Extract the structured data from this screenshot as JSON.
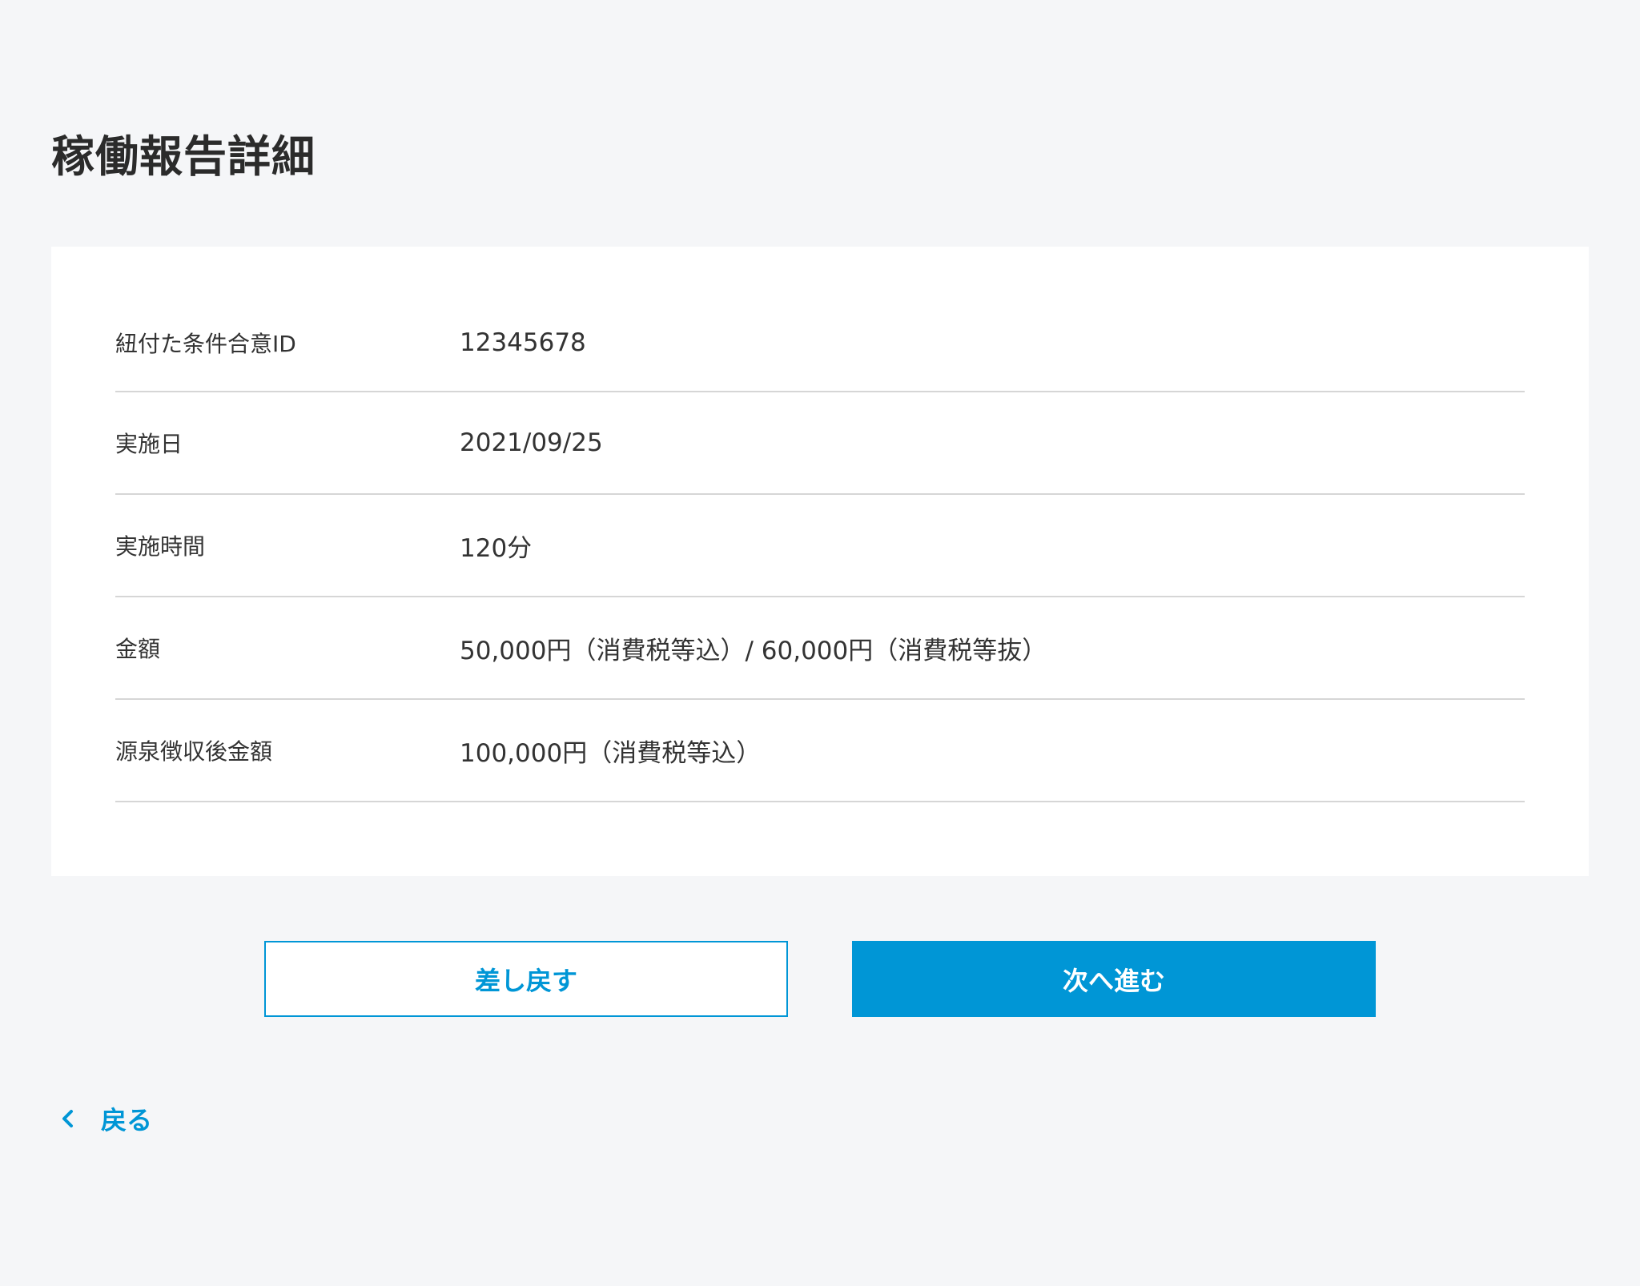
{
  "page": {
    "title": "稼働報告詳細"
  },
  "details": {
    "rows": [
      {
        "label": "紐付た条件合意ID",
        "value": "12345678"
      },
      {
        "label": "実施日",
        "value": "2021/09/25"
      },
      {
        "label": "実施時間",
        "value": "120分"
      },
      {
        "label": "金額",
        "value": "50,000円（消費税等込）/ 60,000円（消費税等抜）"
      },
      {
        "label": "源泉徴収後金額",
        "value": "100,000円（消費税等込）"
      }
    ]
  },
  "actions": {
    "reject_label": "差し戻す",
    "next_label": "次へ進む"
  },
  "nav": {
    "back_label": "戻る",
    "back_icon": "chevron-left-icon"
  },
  "colors": {
    "accent": "#0096d6",
    "background": "#f5f6f8",
    "card": "#ffffff",
    "divider": "#d6d6d6"
  }
}
